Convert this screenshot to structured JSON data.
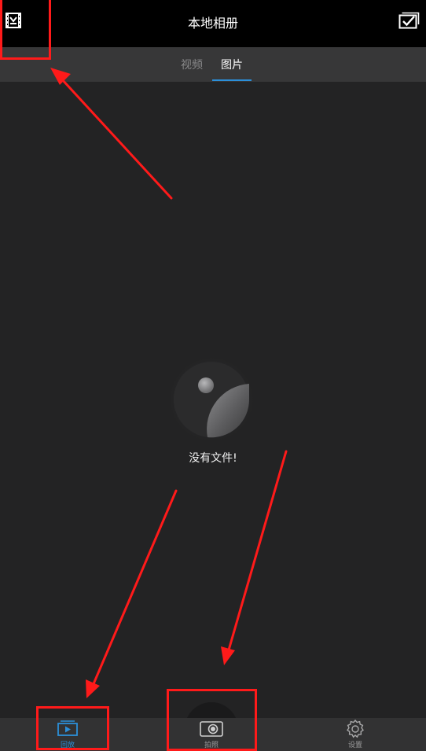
{
  "header": {
    "title": "本地相册",
    "left_icon": "film-gallery-icon",
    "right_icon": "multi-select-check-icon"
  },
  "tabs": [
    {
      "label": "视频",
      "active": false
    },
    {
      "label": "图片",
      "active": true
    }
  ],
  "empty_state": {
    "icon": "empty-lens-icon",
    "message": "没有文件!"
  },
  "bottom_nav": [
    {
      "label": "回放",
      "icon": "playback-icon",
      "active": true
    },
    {
      "label": "拍照",
      "icon": "camera-icon",
      "active": false
    },
    {
      "label": "设置",
      "icon": "gear-icon",
      "active": false
    }
  ],
  "colors": {
    "header_bg": "#000000",
    "tabbar_bg": "#373738",
    "content_bg": "#232324",
    "bottom_nav_bg": "#323233",
    "accent": "#2b8fd9",
    "annotation": "#ff1a1a"
  }
}
